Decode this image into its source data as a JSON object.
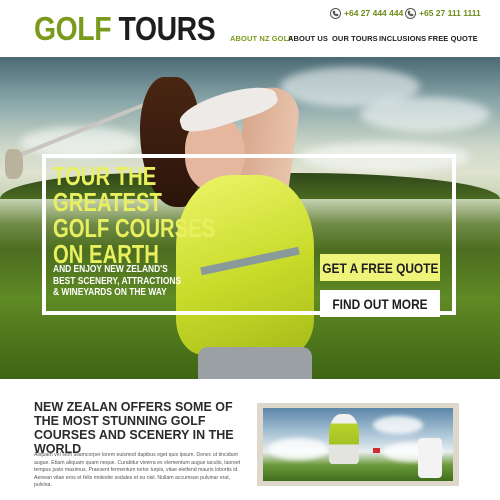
{
  "brand": {
    "word1": "GOLF",
    "word2": "TOURS"
  },
  "contact": {
    "phone1": "+64 27 444 444",
    "phone2": "+65 27 111 1111"
  },
  "nav": {
    "items": [
      {
        "label": "ABOUT NZ GOLF",
        "active": true
      },
      {
        "label": "ABOUT US",
        "active": false
      },
      {
        "label": "OUR TOURS",
        "active": false
      },
      {
        "label": "INCLUSIONS",
        "active": false
      },
      {
        "label": "FREE QUOTE",
        "active": false
      }
    ]
  },
  "hero": {
    "headline": [
      "TOUR THE",
      "GREATEST",
      "GOLF COURSES",
      "ON EARTH"
    ],
    "subline": [
      "AND ENJOY NEW ZELAND'S",
      "BEST SCENERY, ATTRACTIONS",
      "& WINEYARDS ON THE WAY"
    ],
    "cta_quote": "GET A FREE QUOTE",
    "cta_more": "FIND OUT MORE"
  },
  "section": {
    "title": "NEW ZEALAN OFFERS SOME OF THE MOST STUNNING GOLF COURSES AND SCENERY IN THE WORLD",
    "body": "Aliquam vel sem ullamcorper lorem euismod dapibus eget quis ipsum. Donec ut tincidunt augue. Etiam aliquam quam neque. Curabitur viverra ex elementum augue iaculis, laoreet tempus justo maximus. Praesent fermentum tortor turpis, vitae eleifend mauris lobortis id. Aenean vitae eros et felis molestie sodales et eu nisl. Nullam accumsan pulvinar erat, pulvina."
  },
  "colors": {
    "accent_green": "#7a9a1c",
    "headline_yellow": "#e8f060",
    "button_yellow": "#eef37a"
  },
  "icons": {
    "phone": "phone-icon"
  }
}
